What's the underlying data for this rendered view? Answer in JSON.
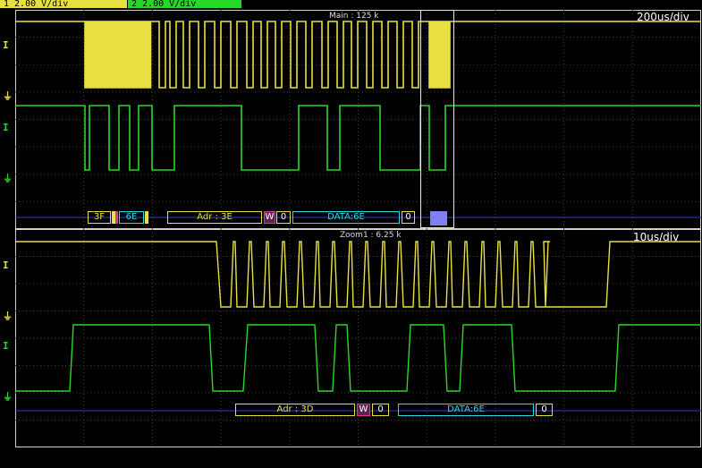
{
  "channels": {
    "ch1_badge": "1  2.00 V/div",
    "ch2_badge": "2  2.00 V/div",
    "ch1_color": "#e8e040",
    "ch2_color": "#28d828"
  },
  "main": {
    "label": "Main : 125 k",
    "timebase": "200us/div",
    "decode": {
      "b1": "3F",
      "b2": "6E",
      "adr": "Adr : 3E",
      "w": "W",
      "ack1": "0",
      "data": "DATA:6E",
      "ack2": "0"
    }
  },
  "zoom": {
    "label": "Zoom1 : 6.25 k",
    "timebase": "10us/div",
    "decode": {
      "adr": "Adr : 3D",
      "w": "W",
      "ack1": "0",
      "data": "DATA:6E",
      "ack2": "0"
    }
  },
  "markers": {
    "trig_icon": "trigger-level-icon",
    "ground_icon": "ground-icon"
  }
}
